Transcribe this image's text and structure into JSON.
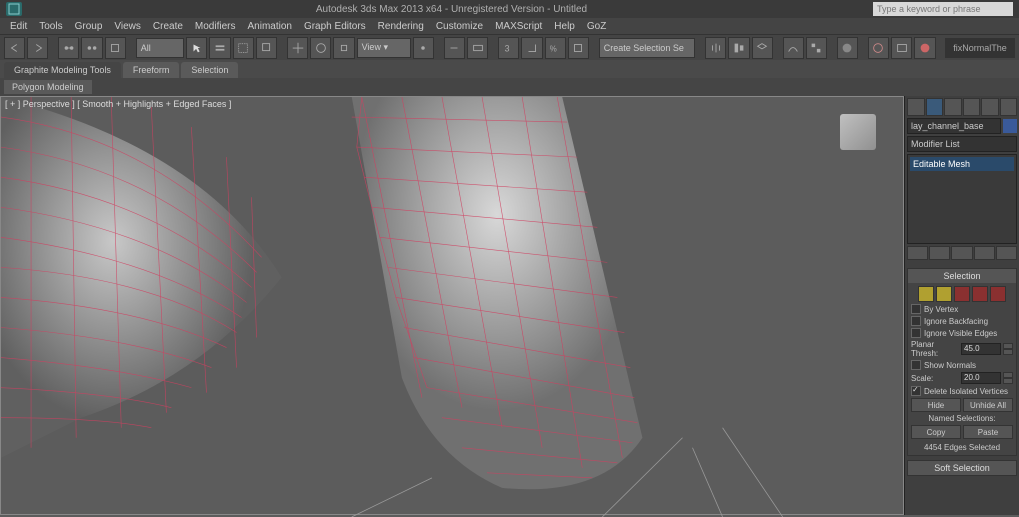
{
  "titlebar": {
    "title": "Autodesk 3ds Max 2013 x64 - Unregistered Version - Untitled",
    "search_placeholder": "Type a keyword or phrase"
  },
  "menu": {
    "items": [
      "Edit",
      "Tools",
      "Group",
      "Views",
      "Create",
      "Modifiers",
      "Animation",
      "Graph Editors",
      "Rendering",
      "Customize",
      "MAXScript",
      "Help",
      "GoZ"
    ]
  },
  "toolbar": {
    "selection_filter": "All",
    "selection_set": "Create Selection Se",
    "modifier_label": "fixNormalThe"
  },
  "ribbon": {
    "tabs": [
      "Graphite Modeling Tools",
      "Freeform",
      "Selection"
    ],
    "active_tab": 0,
    "sub_label": "Polygon Modeling"
  },
  "viewport": {
    "label": "[ + ] Perspective ] [ Smooth + Highlights + Edged Faces ]"
  },
  "panel": {
    "object_name": "lay_channel_base",
    "modifier_dropdown": "Modifier List",
    "stack_item": "Editable Mesh",
    "rollouts": {
      "selection": {
        "title": "Selection",
        "by_vertex": "By Vertex",
        "ignore_backfacing": "Ignore Backfacing",
        "ignore_visible": "Ignore Visible Edges",
        "planar_thresh": "Planar Thresh:",
        "planar_value": "45.0",
        "show_normals": "Show Normals",
        "scale_label": "Scale:",
        "scale_value": "20.0",
        "delete_isolated": "Delete Isolated Vertices",
        "hide": "Hide",
        "unhide_all": "Unhide All",
        "named_selections": "Named Selections:",
        "copy": "Copy",
        "paste": "Paste",
        "status": "4454 Edges Selected"
      },
      "soft_selection": {
        "title": "Soft Selection"
      }
    }
  }
}
